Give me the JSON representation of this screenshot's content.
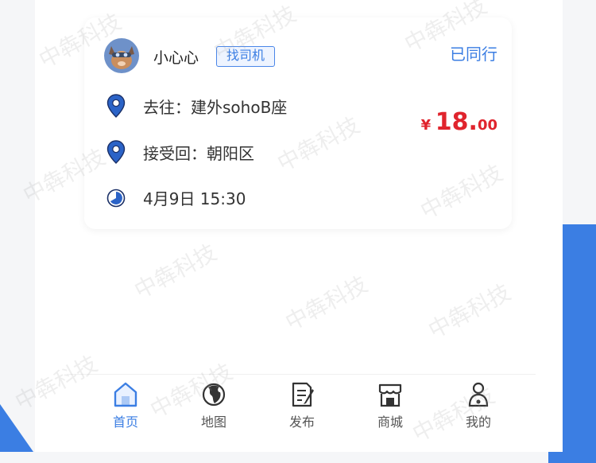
{
  "card": {
    "username": "小心心",
    "tag": "找司机",
    "status": "已同行",
    "destination": "去往：建外sohoB座",
    "pickup": "接受回：朝阳区",
    "time": "4月9日 15:30",
    "price": {
      "currency": "¥",
      "integer": "18.",
      "decimal": "00"
    }
  },
  "tabbar": {
    "items": [
      {
        "label": "首页",
        "icon": "home-icon",
        "active": true
      },
      {
        "label": "地图",
        "icon": "globe-icon",
        "active": false
      },
      {
        "label": "发布",
        "icon": "edit-icon",
        "active": false
      },
      {
        "label": "商城",
        "icon": "store-icon",
        "active": false
      },
      {
        "label": "我的",
        "icon": "user-icon",
        "active": false
      }
    ]
  },
  "watermark": "中犇科技",
  "colors": {
    "accent": "#3b7ee3",
    "price": "#e0242d"
  }
}
